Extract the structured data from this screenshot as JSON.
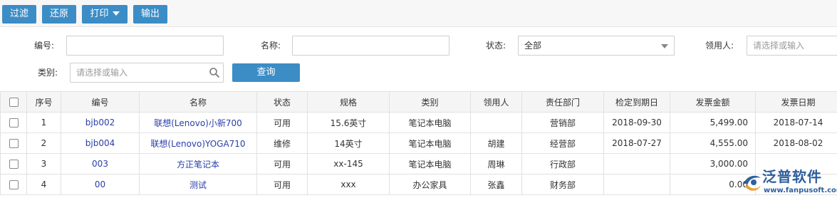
{
  "toolbar": {
    "filter_label": "过滤",
    "restore_label": "还原",
    "print_label": "打印",
    "export_label": "输出"
  },
  "filters": {
    "code_label": "编号:",
    "code_value": "",
    "name_label": "名称:",
    "name_value": "",
    "status_label": "状态:",
    "status_value": "全部",
    "user_label": "领用人:",
    "user_placeholder": "请选择或输入",
    "category_label": "类别:",
    "category_placeholder": "请选择或输入",
    "query_label": "查询"
  },
  "table": {
    "headers": [
      "序号",
      "编号",
      "名称",
      "状态",
      "规格",
      "类别",
      "领用人",
      "责任部门",
      "检定到期日",
      "发票金额",
      "发票日期"
    ],
    "rows": [
      [
        "1",
        "bjb002",
        "联想(Lenovo)小新700",
        "可用",
        "15.6英寸",
        "笔记本电脑",
        "",
        "营销部",
        "2018-09-30",
        "5,499.00",
        "2018-07-14"
      ],
      [
        "2",
        "bjb004",
        "联想(Lenovo)YOGA710",
        "维修",
        "14英寸",
        "笔记本电脑",
        "胡建",
        "经营部",
        "2018-07-27",
        "4,555.00",
        "2018-08-02"
      ],
      [
        "3",
        "003",
        "方正笔记本",
        "可用",
        "xx-145",
        "笔记本电脑",
        "周琳",
        "行政部",
        "",
        "3,000.00",
        ""
      ],
      [
        "4",
        "00",
        "测试",
        "可用",
        "xxx",
        "办公家具",
        "张鑫",
        "财务部",
        "",
        "0.00",
        ""
      ]
    ]
  },
  "logo": {
    "text": "泛普软件",
    "url": "www.fanpusoft.com"
  },
  "colors": {
    "button_blue": "#3c8dc6",
    "link_blue": "#2a3fa8",
    "logo_blue": "#2f5f9e"
  }
}
